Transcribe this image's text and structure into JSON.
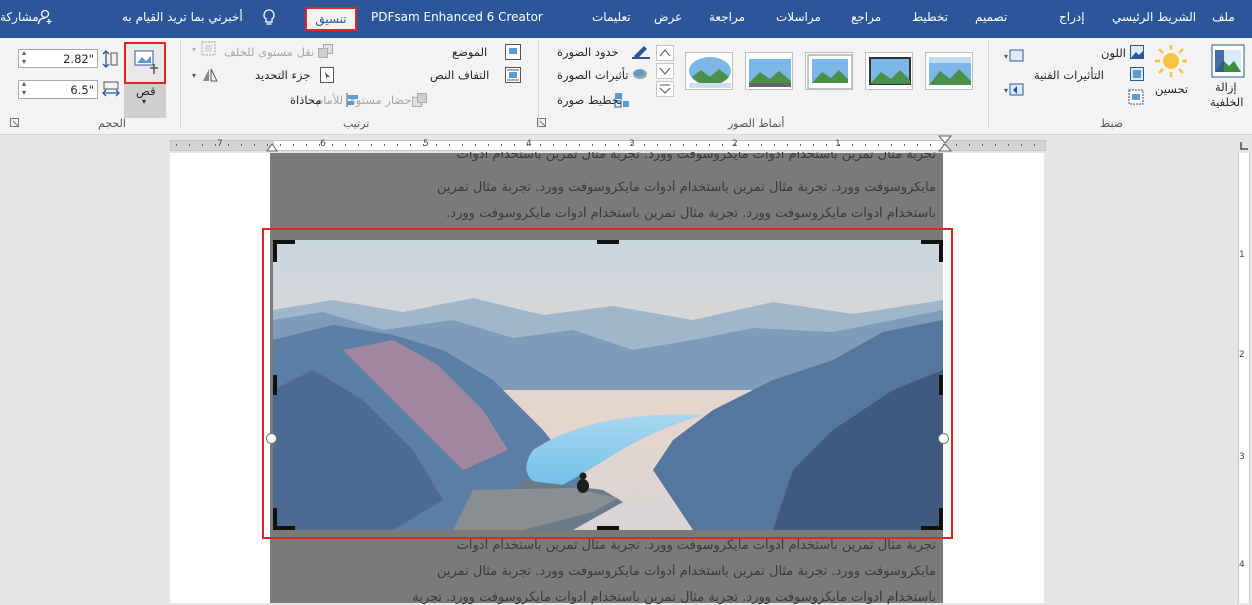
{
  "tabs": {
    "file": "ملف",
    "home": "الشريط الرئيسي",
    "insert": "إدراج",
    "design": "تصميم",
    "layout": "تخطيط",
    "references": "مراجع",
    "mailings": "مراسلات",
    "review": "مراجعة",
    "view": "عرض",
    "help": "تعليمات",
    "addin": "PDFsam Enhanced 6 Creator",
    "format": "تنسيق",
    "tell_me": "أخبرني بما تريد القيام به",
    "share": "مشاركة"
  },
  "adjust": {
    "remove_bg": "إزالة",
    "remove_bg2": "الخلفية",
    "corrections": "تحسين",
    "color": "اللون",
    "artistic": "التأثيرات الفنية",
    "group_label": "ضبط"
  },
  "styles": {
    "border": "حدود الصورة",
    "effects": "تأثيرات الصورة",
    "layout": "تخطيط صورة",
    "group_label": "أنماط الصور"
  },
  "arrange": {
    "position": "الموضع",
    "wrap": "التفاف النص",
    "bring_forward": "إحضار مستوى للأمام",
    "send_backward": "نقل مستوى للخلف",
    "selection_pane": "جزء التحديد",
    "align": "محاذاة",
    "group_label": "ترتيب"
  },
  "size": {
    "crop": "قص",
    "height": "2.82\"",
    "width": "6.5\"",
    "group_label": "الحجم"
  },
  "ruler": {
    "h_numbers": [
      "7",
      "6",
      "5",
      "4",
      "3",
      "2",
      "1"
    ],
    "v_numbers": [
      "1",
      "2",
      "3",
      "4"
    ]
  },
  "document": {
    "line1": "تجربة مثال تمرين باستخدام أدوات مايكروسوفت وورد. تجربة مثال تمرين باستخدام أدوات",
    "line2": "مايكروسوفت وورد. تجربة مثال تمرين باستخدام أدوات مايكروسوفت وورد. تجربة مثال تمرين",
    "line3": "باستخدام أدوات مايكروسوفت وورد. تجربة مثال تمرين باستخدام أدوات مايكروسوفت وورد.",
    "line4": "تجربة مثال تمرين باستخدام أدوات مايكروسوفت وورد. تجربة مثال تمرين باستخدام أدوات",
    "line5": "مايكروسوفت وورد. تجربة مثال تمرين باستخدام أدوات مايكروسوفت وورد. تجربة مثال تمرين",
    "line6": "باستخدام أدوات مايكروسوفت وورد. تجربة مثال تمرين باستخدام أدوات مايكروسوفت وورد. تجربة"
  },
  "colors": {
    "ribbon_blue": "#2b579a",
    "highlight_red": "#e02424"
  }
}
